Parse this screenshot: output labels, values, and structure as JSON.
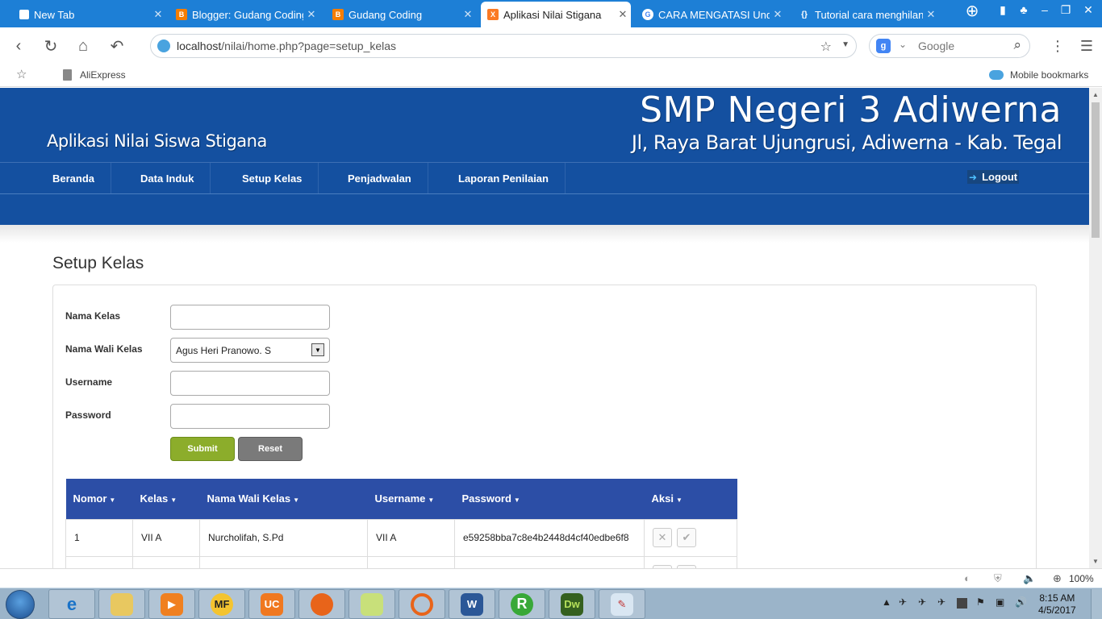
{
  "browser": {
    "tabs": [
      {
        "title": "New Tab",
        "icon": "newtab-icon",
        "color": "#ffffff",
        "active": false
      },
      {
        "title": "Blogger: Gudang Coding",
        "icon": "blogger-icon",
        "color": "#f57d00",
        "active": false
      },
      {
        "title": "Gudang Coding",
        "icon": "blogger-icon",
        "color": "#f57d00",
        "active": false
      },
      {
        "title": "Aplikasi Nilai Stigana",
        "icon": "xampp-icon",
        "color": "#fb7a24",
        "active": true
      },
      {
        "title": "CARA MENGATASI Unde",
        "icon": "google-icon",
        "color": "#4285f4",
        "active": false
      },
      {
        "title": "Tutorial cara menghilang",
        "icon": "code-icon",
        "color": "#ffffff",
        "active": false
      }
    ],
    "address": {
      "host": "localhost",
      "path": "/nilai/home.php?page=setup_kelas"
    },
    "search_placeholder": "Google",
    "bookmarks": {
      "left": "AliExpress",
      "right": "Mobile bookmarks"
    },
    "status_zoom": "100%"
  },
  "site": {
    "app_title": "Aplikasi Nilai Siswa Stigana",
    "school_name": "SMP Negeri 3 Adiwerna",
    "school_address": "Jl, Raya Barat Ujungrusi, Adiwerna - Kab. Tegal",
    "nav": [
      "Beranda",
      "Data Induk",
      "Setup Kelas",
      "Penjadwalan",
      "Laporan Penilaian"
    ],
    "logout": "Logout",
    "colors": {
      "header": "#1450a0",
      "table_header": "#2c4ea6",
      "submit": "#8cad2b",
      "reset": "#7a7a7a"
    }
  },
  "page": {
    "title": "Setup Kelas",
    "form": {
      "nama_kelas_label": "Nama Kelas",
      "nama_kelas_value": "",
      "wali_label": "Nama Wali Kelas",
      "wali_selected": "Agus Heri Pranowo. S",
      "username_label": "Username",
      "username_value": "",
      "password_label": "Password",
      "password_value": "",
      "submit": "Submit",
      "reset": "Reset"
    },
    "table": {
      "headers": [
        "Nomor",
        "Kelas",
        "Nama Wali Kelas",
        "Username",
        "Password",
        "Aksi"
      ],
      "rows": [
        {
          "nomor": "1",
          "kelas": "VII A",
          "wali": "Nurcholifah, S.Pd",
          "username": "VII A",
          "password": "e59258bba7c8e4b2448d4cf40edbe6f8"
        },
        {
          "nomor": "",
          "kelas": "",
          "wali": "",
          "username": "",
          "password": ""
        }
      ]
    }
  },
  "taskbar": {
    "apps": [
      "Internet Explorer",
      "Windows Explorer",
      "Media Player",
      "MF",
      "UC Browser",
      "Firefox",
      "Sticky Notes",
      "Ubuntu",
      "Word",
      "R",
      "Dw",
      "Paint"
    ],
    "clock_time": "8:15 AM",
    "clock_date": "4/5/2017"
  }
}
